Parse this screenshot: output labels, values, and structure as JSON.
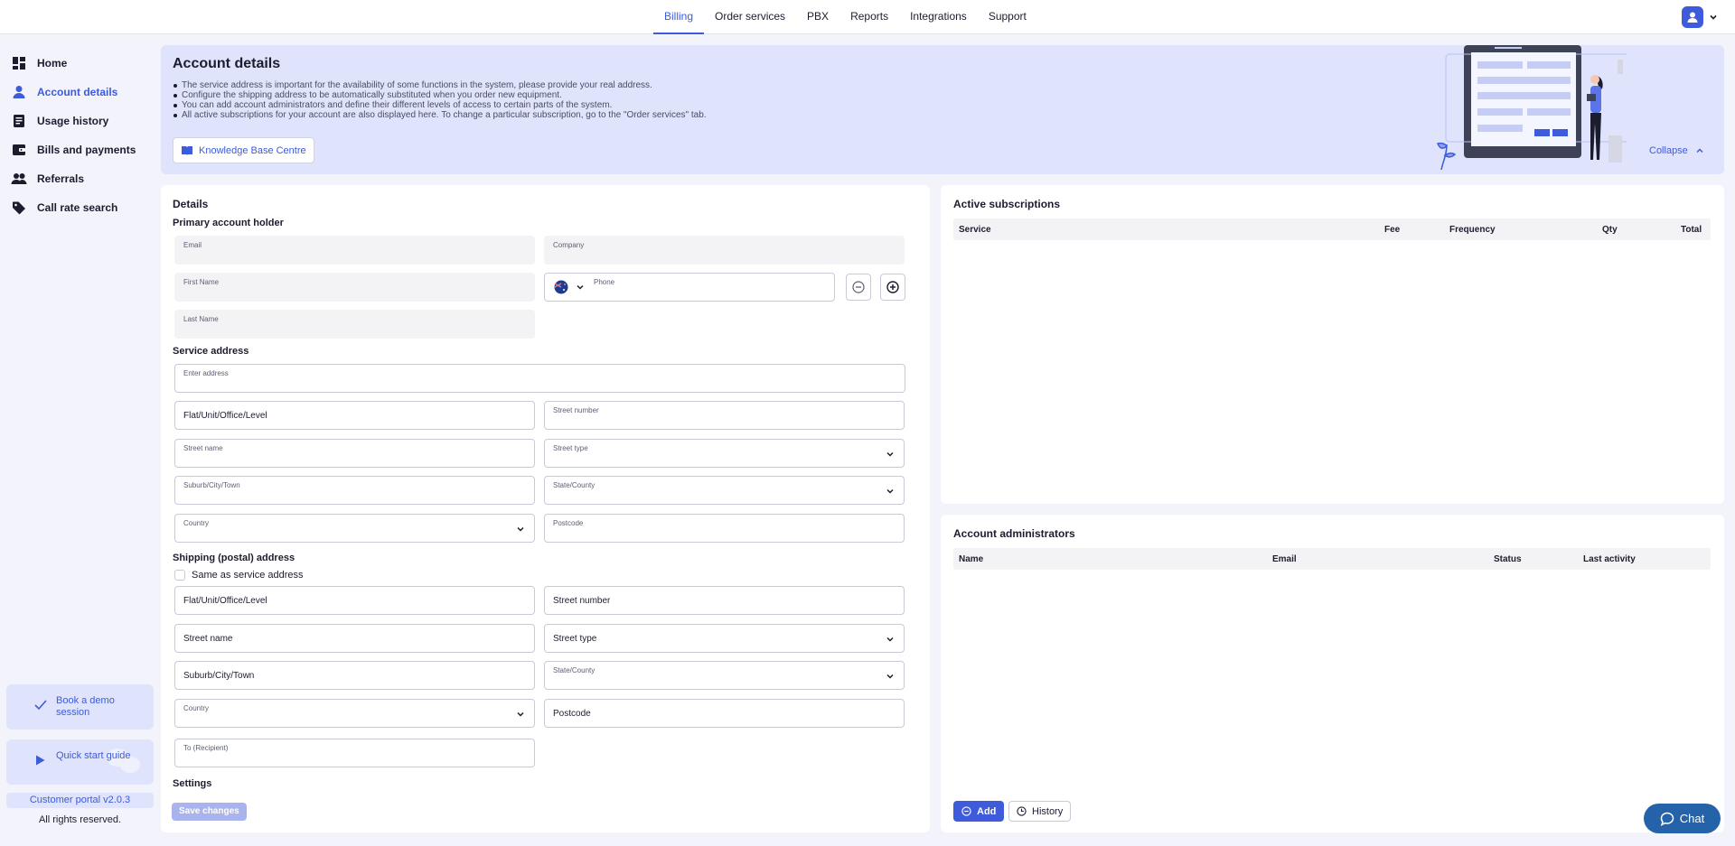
{
  "topnav": {
    "tabs": [
      {
        "label": "Billing",
        "active": true
      },
      {
        "label": "Order services"
      },
      {
        "label": "PBX"
      },
      {
        "label": "Reports"
      },
      {
        "label": "Integrations"
      },
      {
        "label": "Support"
      }
    ]
  },
  "sidebar": {
    "items": [
      {
        "label": "Home",
        "icon": "dashboard-icon"
      },
      {
        "label": "Account details",
        "icon": "person-icon",
        "active": true
      },
      {
        "label": "Usage history",
        "icon": "document-icon"
      },
      {
        "label": "Bills and payments",
        "icon": "wallet-icon"
      },
      {
        "label": "Referrals",
        "icon": "people-icon"
      },
      {
        "label": "Call rate search",
        "icon": "tag-icon"
      }
    ],
    "demo_label": "Book a demo session",
    "guide_label": "Quick start guide",
    "version": "Customer portal v2.0.3",
    "rights": "All rights reserved."
  },
  "banner": {
    "title": "Account details",
    "bullets": [
      "The service address is important for the availability of some functions in the system, please provide your real address.",
      "Configure the shipping address to be automatically substituted when you order new equipment.",
      "You can add account administrators and define their different levels of access to certain parts of the system.",
      "All active subscriptions for your account are also displayed here. To change a particular subscription, go to the \"Order services\" tab."
    ],
    "kb_label": "Knowledge Base Centre",
    "collapse_label": "Collapse"
  },
  "details": {
    "title": "Details",
    "primary_heading": "Primary account holder",
    "email_label": "Email",
    "company_label": "Company",
    "first_name_label": "First Name",
    "phone_label": "Phone",
    "last_name_label": "Last Name",
    "service_heading": "Service address",
    "service": {
      "address_label": "Enter address",
      "flat_placeholder": "Flat/Unit/Office/Level",
      "street_number_label": "Street number",
      "street_name_label": "Street name",
      "street_type_label": "Street type",
      "suburb_label": "Suburb/City/Town",
      "state_label": "State/County",
      "country_label": "Country",
      "postcode_label": "Postcode"
    },
    "shipping_heading": "Shipping (postal) address",
    "same_as_label": "Same as service address",
    "shipping": {
      "flat_placeholder": "Flat/Unit/Office/Level",
      "street_number_placeholder": "Street number",
      "street_name_placeholder": "Street name",
      "street_type_placeholder": "Street type",
      "suburb_placeholder": "Suburb/City/Town",
      "state_label": "State/County",
      "country_label": "Country",
      "postcode_placeholder": "Postcode",
      "recipient_label": "To (Recipient)"
    },
    "settings_heading": "Settings",
    "save_label": "Save changes"
  },
  "subscriptions": {
    "title": "Active subscriptions",
    "columns": [
      "Service",
      "Fee",
      "Frequency",
      "Qty",
      "Total"
    ]
  },
  "admins": {
    "title": "Account administrators",
    "columns": [
      "Name",
      "Email",
      "Status",
      "Last activity"
    ],
    "add_label": "Add",
    "history_label": "History"
  },
  "chat_label": "Chat",
  "colors": {
    "accent": "#3d5bdb",
    "banner": "#dfe3fb",
    "chat": "#2463a9"
  }
}
